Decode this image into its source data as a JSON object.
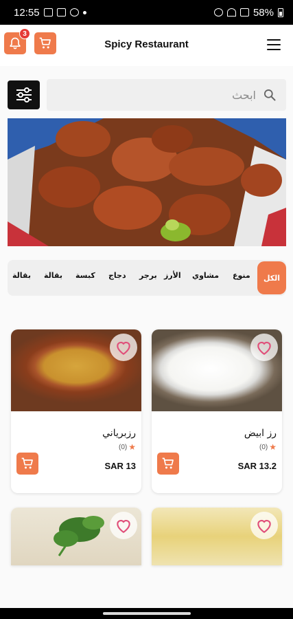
{
  "status_bar": {
    "time": "12:55",
    "battery": "58%"
  },
  "header": {
    "title": "Spicy Restaurant",
    "notification_count": "3"
  },
  "search": {
    "placeholder": "ابحث"
  },
  "categories": [
    "الكل",
    "منوع",
    "مشاوي",
    "الأرز",
    "برجر",
    "دجاج",
    "كبسة",
    "بقالة",
    "بقالة"
  ],
  "products": [
    {
      "name": "رز ابيض",
      "rating": "(0)",
      "price": "SAR 13.2"
    },
    {
      "name": "رزبرياني",
      "rating": "(0)",
      "price": "SAR 13"
    },
    {
      "name": "",
      "rating": "",
      "price": ""
    },
    {
      "name": "",
      "rating": "",
      "price": ""
    }
  ],
  "colors": {
    "accent": "#ef7a4b",
    "badge": "#e53935",
    "dark": "#111111",
    "search_bg": "#efefef"
  },
  "icons": {
    "notifications": "bell-icon",
    "cart": "cart-icon",
    "menu": "hamburger-menu-icon",
    "filter": "sliders-filter-icon",
    "search": "search-icon",
    "favorite": "heart-outline-icon",
    "rating": "star-icon"
  }
}
